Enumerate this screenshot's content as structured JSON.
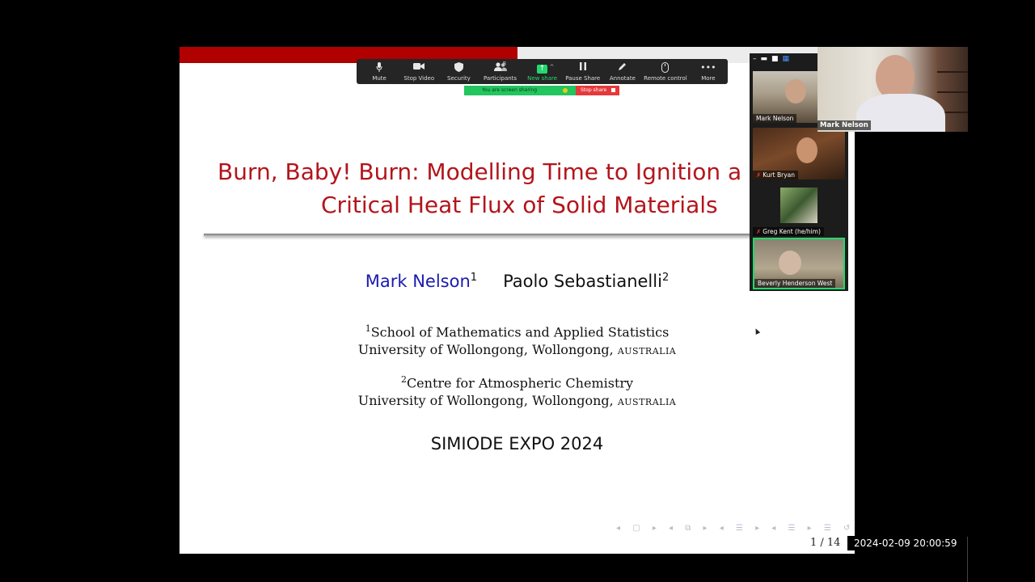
{
  "slide": {
    "title_line1": "Burn, Baby! Burn: Modelling Time to Ignition a",
    "title_line2": "Critical Heat Flux of Solid Materials",
    "author1": "Mark Nelson",
    "author1_sup": "1",
    "author2": "Paolo Sebastianelli",
    "author2_sup": "2",
    "affil1_sup": "1",
    "affil1_line1": "School of Mathematics and Applied Statistics",
    "affil1_line2": "University of Wollongong, Wollongong, ",
    "affil1_country": "australia",
    "affil2_sup": "2",
    "affil2_line1": "Centre for Atmospheric Chemistry",
    "affil2_line2": "University of Wollongong, Wollongong, ",
    "affil2_country": "australia",
    "event": "SIMIODE EXPO 2024",
    "page": "1 / 14"
  },
  "timestamp": "2024-02-09 20:00:59",
  "toolbar": {
    "mute": "Mute",
    "stop_video": "Stop Video",
    "security": "Security",
    "participants": "Participants",
    "participants_count": "8",
    "new_share": "New share",
    "pause_share": "Pause Share",
    "annotate": "Annotate",
    "remote_control": "Remote control",
    "more": "More"
  },
  "sharing": {
    "status": "You are screen sharing",
    "stop": "Stop share"
  },
  "participants": [
    {
      "name": "Mark Nelson",
      "muted": false
    },
    {
      "name": "Kurt Bryan",
      "muted": true
    },
    {
      "name": "Greg Kent (he/him)",
      "muted": true
    },
    {
      "name": "Beverly Henderson West",
      "muted": false
    }
  ],
  "active_speaker": {
    "name": "Mark Nelson"
  },
  "colors": {
    "slide_title": "#b3151b",
    "author_link": "#1a1ab0",
    "header_bar": "#b00000",
    "share_green": "#23d96c",
    "stop_red": "#e5393b"
  },
  "icons": [
    "mic-icon",
    "video-camera-icon",
    "shield-icon",
    "participants-icon",
    "share-screen-icon",
    "pause-icon",
    "pen-icon",
    "mouse-icon",
    "more-dots-icon"
  ]
}
